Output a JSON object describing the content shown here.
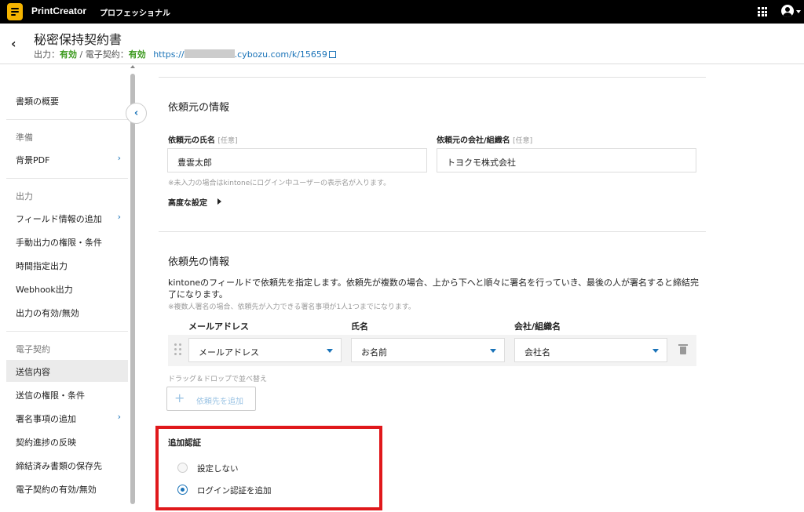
{
  "app": {
    "brand": "PrintCreator",
    "edition": "プロフェッショナル"
  },
  "header": {
    "title": "秘密保持契約書",
    "output_label": "出力：",
    "output_value": "有効",
    "sep": " / ",
    "contract_label": "電子契約：",
    "contract_value": "有効",
    "url_prefix": "https://",
    "url_suffix": ".cybozu.com/k/15659"
  },
  "sidebar": {
    "overview": "書類の概要",
    "group_prep": "準備",
    "bg_pdf": "背景PDF",
    "group_output": "出力",
    "add_field": "フィールド情報の追加",
    "manual_perm": "手動出力の権限・条件",
    "scheduled": "時間指定出力",
    "webhook": "Webhook出力",
    "output_toggle": "出力の有効/無効",
    "group_contract": "電子契約",
    "send_content": "送信内容",
    "send_perm": "送信の権限・条件",
    "add_sign": "署名事項の追加",
    "progress": "契約進捗の反映",
    "saved_dest": "締結済み書類の保存先",
    "contract_toggle": "電子契約の有効/無効"
  },
  "requester": {
    "section_title": "依頼元の情報",
    "name_label": "依頼元の氏名",
    "name_opt": "[任意]",
    "name_value": "豊雲太郎",
    "org_label": "依頼元の会社/組織名",
    "org_opt": "[任意]",
    "org_value": "トヨクモ株式会社",
    "hint": "※未入力の場合はkintoneにログイン中ユーザーの表示名が入ります。",
    "advanced": "高度な設定"
  },
  "recipient": {
    "section_title": "依頼先の情報",
    "desc": "kintoneのフィールドで依頼先を指定します。依頼先が複数の場合、上から下へと順々に署名を行っていき、最後の人が署名すると締結完了になります。",
    "note": "※複数人署名の場合、依頼先が入力できる署名事項が1人1つまでになります。",
    "col_email": "メールアドレス",
    "col_name": "氏名",
    "col_org": "会社/組織名",
    "sel_email": "メールアドレス",
    "sel_name": "お名前",
    "sel_org": "会社名",
    "drag_hint": "ドラッグ＆ドロップで並べ替え",
    "add_button": "依頼先を追加"
  },
  "auth": {
    "title": "追加認証",
    "opt_none": "設定しない",
    "opt_login": "ログイン認証を追加",
    "selected": "ログイン認証を追加"
  },
  "colors": {
    "accent": "#1a73b8",
    "ok": "#3c9a1e",
    "highlight": "#e0181b",
    "brand_icon": "#f5b400"
  }
}
